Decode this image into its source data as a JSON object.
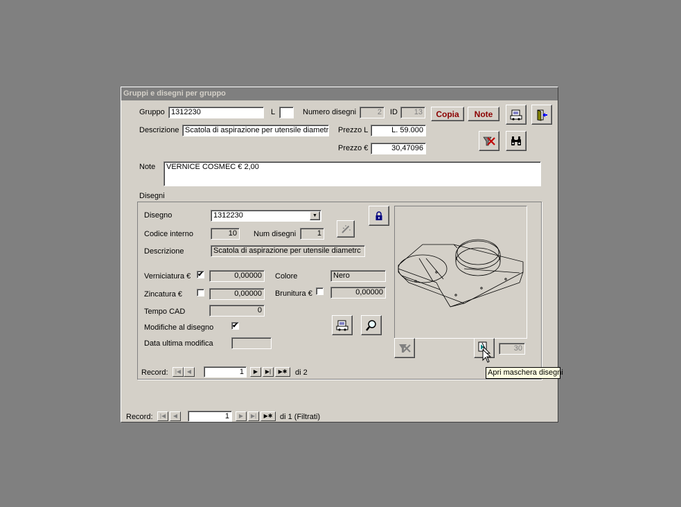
{
  "window": {
    "title": "Gruppi e disegni per gruppo"
  },
  "header": {
    "gruppo_label": "Gruppo",
    "gruppo_value": "1312230",
    "l_label": "L",
    "l_value": "",
    "numero_disegni_label": "Numero disegni",
    "numero_disegni_value": "2",
    "id_label": "ID",
    "id_value": "13",
    "descrizione_label": "Descrizione",
    "descrizione_value": "Scatola di aspirazione per utensile diametrc",
    "prezzo_l_label": "Prezzo L",
    "prezzo_l_value": "L. 59.000",
    "prezzo_eur_label": "Prezzo €",
    "prezzo_eur_value": "30,47096",
    "note_label": "Note",
    "note_value": "VERNICE COSMEC € 2,00",
    "copia_label": "Copia",
    "note_button_label": "Note"
  },
  "disegni": {
    "section_label": "Disegni",
    "disegno_label": "Disegno",
    "disegno_value": "1312230",
    "codice_interno_label": "Codice interno",
    "codice_interno_value": "10",
    "num_disegni_label": "Num disegni",
    "num_disegni_value": "1",
    "descrizione_label": "Descrizione",
    "descrizione_value": "Scatola di aspirazione per utensile diametrc",
    "verniciatura_label": "Verniciatura €",
    "verniciatura_value": "0,00000",
    "verniciatura_checked": "✔",
    "colore_label": "Colore",
    "colore_value": "Nero",
    "zincatura_label": "Zincatura €",
    "zincatura_value": "0,00000",
    "zincatura_checked": "",
    "brunitura_label": "Brunitura €",
    "brunitura_value": "0,00000",
    "brunitura_checked": "",
    "tempo_cad_label": "Tempo CAD",
    "tempo_cad_value": "0",
    "modifiche_label": "Modifiche al disegno",
    "modifiche_checked": "✔",
    "data_ultima_label": "Data ultima modifica",
    "data_ultima_value": "",
    "counter_value": "30",
    "record_label": "Record:",
    "record_value": "1",
    "record_total": "di 2"
  },
  "footer": {
    "record_label": "Record:",
    "record_value": "1",
    "record_total": "di 1 (Filtrati)"
  },
  "nav": {
    "first": "|◀",
    "prev": "◀",
    "next": "▶",
    "last": "▶|",
    "new": "▶✱"
  },
  "tooltip": {
    "text": "Apri maschera disegni"
  },
  "icons": {
    "report": "report-icon",
    "exit": "exit-door-icon",
    "delete_filter": "remove-filter-icon",
    "find": "binoculars-icon",
    "lock": "padlock-icon",
    "magic": "wand-icon",
    "zoom": "magnifier-icon",
    "open_drawings": "open-drawing-form-icon"
  },
  "colors": {
    "window_bg": "#d4d0c8",
    "desktop_bg": "#808080",
    "title_bg": "#7f7f7f",
    "accent_text": "#8b0000"
  }
}
